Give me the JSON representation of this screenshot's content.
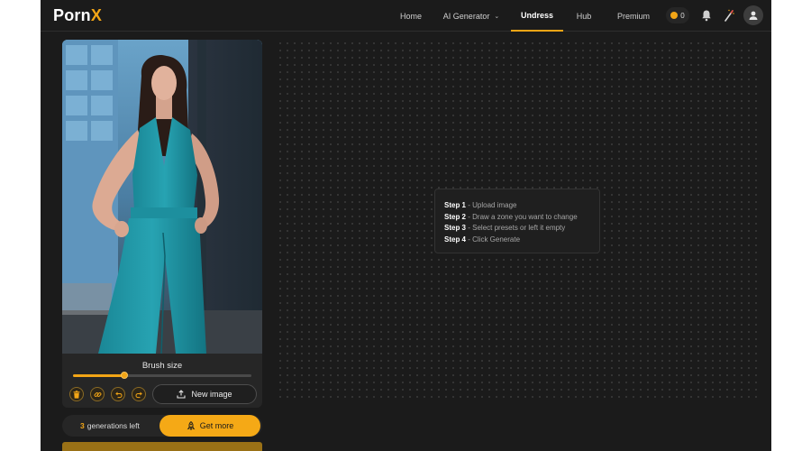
{
  "brand": {
    "name_main": "Porn",
    "name_accent": "X"
  },
  "nav": {
    "items": [
      {
        "label": "Home"
      },
      {
        "label": "AI Generator",
        "has_dropdown": true
      },
      {
        "label": "Undress",
        "active": true
      },
      {
        "label": "Hub"
      },
      {
        "label": "Premium"
      }
    ]
  },
  "header": {
    "coins": "0",
    "icons": [
      "coin-icon",
      "bell-icon",
      "magic-wand-icon",
      "user-avatar-icon"
    ]
  },
  "editor": {
    "brush_label": "Brush size",
    "brush_size": 0.29,
    "tools": [
      "trash-icon",
      "link-icon",
      "undo-icon",
      "redo-icon"
    ],
    "new_image_label": "New image"
  },
  "generations": {
    "count": "3",
    "label": "generations left",
    "cta": "Get more"
  },
  "steps": [
    {
      "label": "Step 1",
      "text": " - Upload image"
    },
    {
      "label": "Step 2",
      "text": " - Draw a zone you want to change"
    },
    {
      "label": "Step 3",
      "text": " - Select presets or left it empty"
    },
    {
      "label": "Step 4",
      "text": " - Click Generate"
    }
  ],
  "colors": {
    "accent": "#f2a516",
    "background": "#1b1b1b",
    "panel": "#262626"
  }
}
